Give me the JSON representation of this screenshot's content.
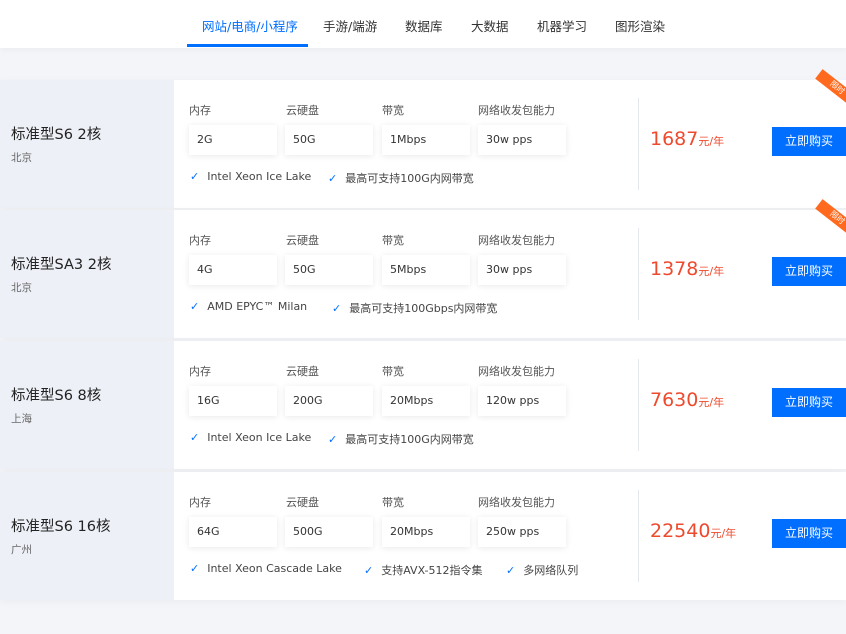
{
  "tabs": [
    {
      "label": "网站/电商/小程序",
      "active": true
    },
    {
      "label": "手游/端游"
    },
    {
      "label": "数据库"
    },
    {
      "label": "大数据"
    },
    {
      "label": "机器学习"
    },
    {
      "label": "图形渲染"
    }
  ],
  "spec_labels": {
    "memory": "内存",
    "disk": "云硬盘",
    "bandwidth": "带宽",
    "pps": "网络收发包能力"
  },
  "price_unit": "元/年",
  "buy_label": "立即购买",
  "ribbon_label": "限时",
  "check_icon": "check-icon",
  "accent_color": "#006eff",
  "price_color": "#ee4a2e",
  "products": [
    {
      "name": "标准型S6 2核",
      "region": "北京",
      "memory": "2G",
      "disk": "50G",
      "bandwidth": "1Mbps",
      "pps": "30w pps",
      "features": [
        "Intel Xeon Ice Lake",
        "最高可支持100G内网带宽"
      ],
      "price": "1687",
      "ribbon": true
    },
    {
      "name": "标准型SA3 2核",
      "region": "北京",
      "memory": "4G",
      "disk": "50G",
      "bandwidth": "5Mbps",
      "pps": "30w pps",
      "features": [
        "AMD EPYC™ Milan",
        "最高可支持100Gbps内网带宽"
      ],
      "price": "1378",
      "ribbon": true
    },
    {
      "name": "标准型S6 8核",
      "region": "上海",
      "memory": "16G",
      "disk": "200G",
      "bandwidth": "20Mbps",
      "pps": "120w pps",
      "features": [
        "Intel Xeon Ice Lake",
        "最高可支持100G内网带宽"
      ],
      "price": "7630",
      "ribbon": false
    },
    {
      "name": "标准型S6 16核",
      "region": "广州",
      "memory": "64G",
      "disk": "500G",
      "bandwidth": "20Mbps",
      "pps": "250w pps",
      "features": [
        "Intel Xeon Cascade Lake",
        "支持AVX-512指令集",
        "多网络队列"
      ],
      "price": "22540",
      "ribbon": false
    }
  ]
}
